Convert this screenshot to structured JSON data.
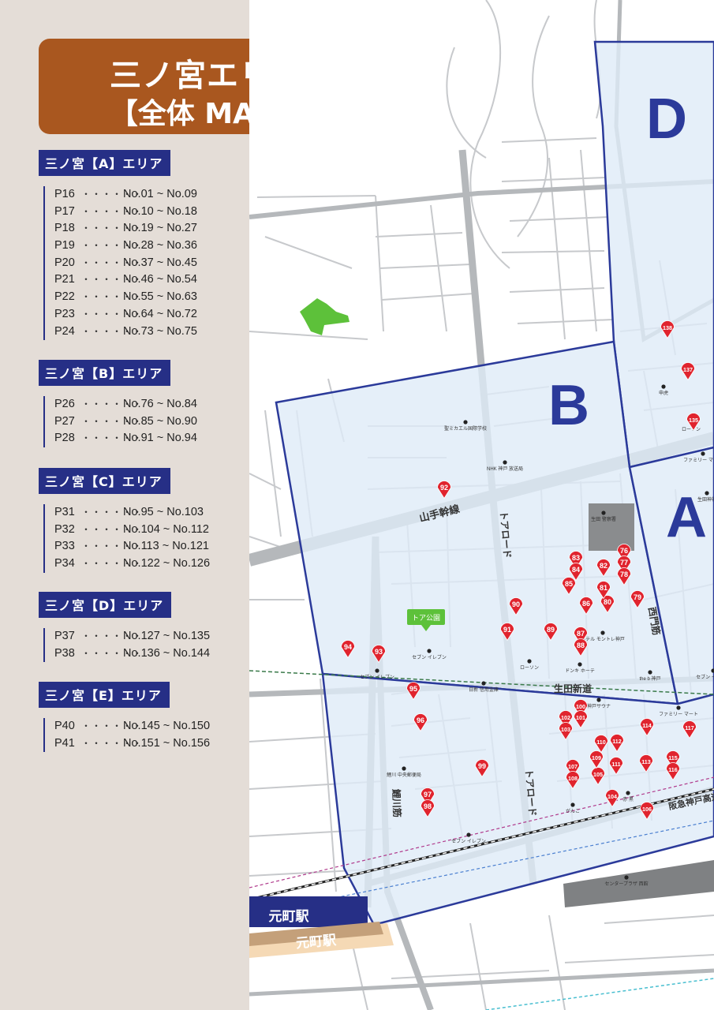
{
  "title": {
    "line1": "三ノ宮エリア",
    "line2": "【全体 MAP】"
  },
  "sections": [
    {
      "heading": "三ノ宮【A】エリア",
      "rows": [
        {
          "page": "P16",
          "range": "No.01 ~ No.09"
        },
        {
          "page": "P17",
          "range": "No.10 ~ No.18"
        },
        {
          "page": "P18",
          "range": "No.19 ~ No.27"
        },
        {
          "page": "P19",
          "range": "No.28 ~ No.36"
        },
        {
          "page": "P20",
          "range": "No.37 ~ No.45"
        },
        {
          "page": "P21",
          "range": "No.46 ~ No.54"
        },
        {
          "page": "P22",
          "range": "No.55 ~ No.63"
        },
        {
          "page": "P23",
          "range": "No.64 ~ No.72"
        },
        {
          "page": "P24",
          "range": "No.73 ~ No.75"
        }
      ]
    },
    {
      "heading": "三ノ宮【B】エリア",
      "rows": [
        {
          "page": "P26",
          "range": "No.76 ~ No.84"
        },
        {
          "page": "P27",
          "range": "No.85 ~ No.90"
        },
        {
          "page": "P28",
          "range": "No.91 ~ No.94"
        }
      ]
    },
    {
      "heading": "三ノ宮【C】エリア",
      "rows": [
        {
          "page": "P31",
          "range": "No.95 ~ No.103"
        },
        {
          "page": "P32",
          "range": "No.104 ~ No.112"
        },
        {
          "page": "P33",
          "range": "No.113 ~ No.121"
        },
        {
          "page": "P34",
          "range": "No.122 ~ No.126"
        }
      ]
    },
    {
      "heading": "三ノ宮【D】エリア",
      "rows": [
        {
          "page": "P37",
          "range": "No.127 ~ No.135"
        },
        {
          "page": "P38",
          "range": "No.136 ~ No.144"
        }
      ]
    },
    {
      "heading": "三ノ宮【E】エリア",
      "rows": [
        {
          "page": "P40",
          "range": "No.145 ~ No.150"
        },
        {
          "page": "P41",
          "range": "No.151 ~ No.156"
        }
      ]
    }
  ],
  "dots": "・・・・・・",
  "map": {
    "zones": [
      "A",
      "B",
      "D"
    ],
    "roads": {
      "yamate": "山手幹線",
      "tor_road": "トアロード",
      "tor_road2": "トアロード",
      "koikawa": "鯉川筋",
      "ikuta": "生田新道",
      "hanshin": "阪急神戸高速線",
      "nishi": "西門筋"
    },
    "stations": {
      "motomachi_jr": "元町駅",
      "motomachi_hanshin": "元町駅"
    },
    "park": "トア公園",
    "landmarks": [
      "聖ミカエル国際学校",
      "NHK 神戸 放送局",
      "生田 警察署",
      "ローソン",
      "ドンキ ホーテ",
      "ホテル モントレ神戸",
      "the b 神戸",
      "神戸サウナ",
      "日新 信用金庫",
      "セブン イレブン",
      "ファミリー マート",
      "鯉川 中央郵便局",
      "がんこ",
      "赤 黒",
      "センタープラザ 西館",
      "セブン イレブン",
      "申虎",
      "ファミリー マート",
      "生田神社",
      "ローソン",
      "セブン イレブン",
      "セブン イレブン"
    ],
    "pins": [
      "76",
      "77",
      "78",
      "79",
      "80",
      "81",
      "82",
      "83",
      "84",
      "85",
      "86",
      "87",
      "88",
      "89",
      "90",
      "91",
      "92",
      "93",
      "94",
      "95",
      "96",
      "97",
      "98",
      "99",
      "100",
      "101",
      "102",
      "103",
      "104",
      "105",
      "106",
      "107",
      "108",
      "109",
      "110",
      "111",
      "112",
      "113",
      "114",
      "115",
      "116",
      "117",
      "135",
      "137",
      "138"
    ]
  },
  "colors": {
    "zone_border": "#2b3a9a",
    "zone_fill": "#deebf7",
    "title_bg": "#a9571f",
    "pin": "#e0242e",
    "park": "#5dc13a"
  }
}
